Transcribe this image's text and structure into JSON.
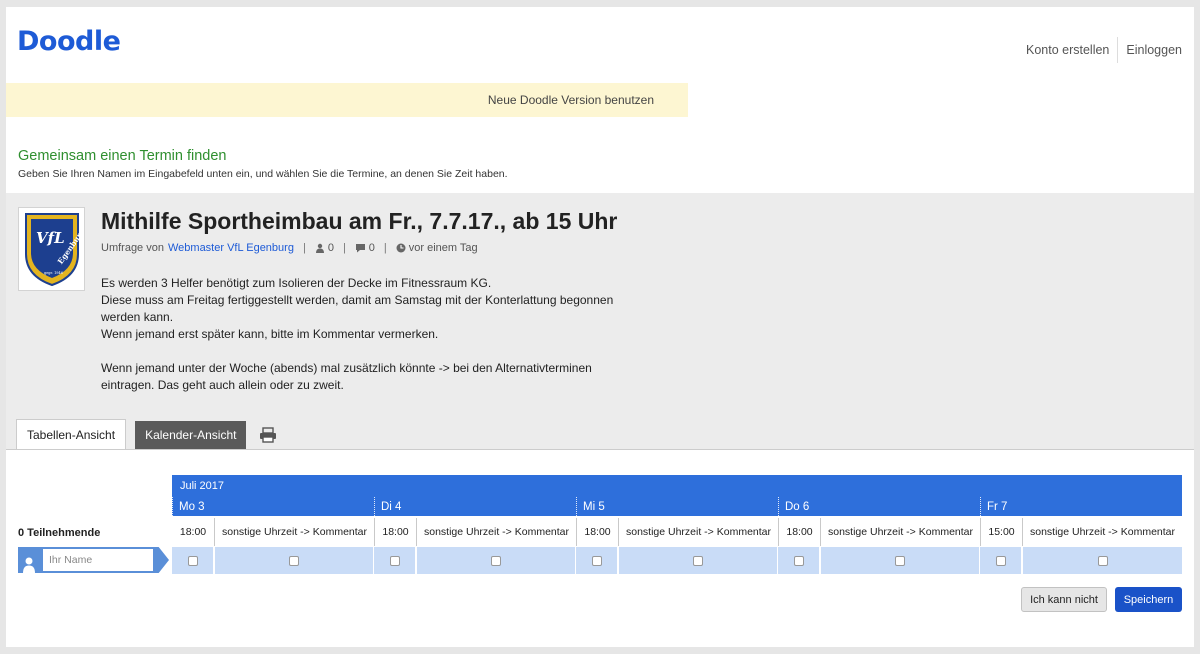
{
  "header": {
    "logo": "Doodle",
    "create_account": "Konto erstellen",
    "login": "Einloggen"
  },
  "banner": {
    "text": "Neue Doodle Version benutzen"
  },
  "intro": {
    "title": "Gemeinsam einen Termin finden",
    "subtitle": "Geben Sie Ihren Namen im Eingabefeld unten ein, und wählen Sie die Termine, an denen Sie Zeit haben."
  },
  "poll": {
    "logo_text": "VfL Egenburg",
    "logo_small": "gegr. 1946",
    "title": "Mithilfe Sportheimbau am Fr., 7.7.17., ab 15 Uhr",
    "by_label": "Umfrage von",
    "author": "Webmaster VfL Egenburg",
    "participants_count": "0",
    "comments_count": "0",
    "created": "vor einem Tag",
    "description": [
      "Es werden 3 Helfer benötigt zum Isolieren der Decke im Fitnessraum KG.",
      "Diese muss am Freitag fertiggestellt werden, damit am Samstag mit der Konterlattung begonnen werden kann.",
      "Wenn jemand erst später kann, bitte im Kommentar vermerken.",
      "Wenn jemand unter der Woche (abends) mal zusätzlich könnte -> bei den Alternativterminen eintragen. Das geht auch allein oder zu zweit."
    ]
  },
  "tabs": {
    "table_view": "Tabellen-Ansicht",
    "calendar_view": "Kalender-Ansicht"
  },
  "grid": {
    "month": "Juli 2017",
    "participants_label": "0 Teilnehmende",
    "name_placeholder": "Ihr Name",
    "days": [
      {
        "label": "Mo 3",
        "time": "18:00",
        "other": "sonstige Uhrzeit -> Kommentar"
      },
      {
        "label": "Di 4",
        "time": "18:00",
        "other": "sonstige Uhrzeit -> Kommentar"
      },
      {
        "label": "Mi 5",
        "time": "18:00",
        "other": "sonstige Uhrzeit -> Kommentar"
      },
      {
        "label": "Do 6",
        "time": "18:00",
        "other": "sonstige Uhrzeit -> Kommentar"
      },
      {
        "label": "Fr 7",
        "time": "15:00",
        "other": "sonstige Uhrzeit -> Kommentar"
      }
    ]
  },
  "actions": {
    "cannot": "Ich kann nicht",
    "save": "Speichern"
  },
  "colors": {
    "brand_blue": "#1e5bd6",
    "header_blue": "#2e6fdb",
    "cell_blue": "#c9dcf7",
    "intro_green": "#2f8f2f",
    "banner_yellow": "#fdf6d2"
  }
}
